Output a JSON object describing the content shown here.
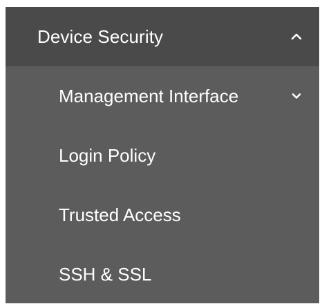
{
  "menu": {
    "section": {
      "label": "Device Security",
      "icon": "chevron-up-icon",
      "expanded": true
    },
    "items": [
      {
        "label": "Management Interface",
        "icon": "chevron-down-icon"
      },
      {
        "label": "Login Policy"
      },
      {
        "label": "Trusted Access"
      },
      {
        "label": "SSH & SSL"
      }
    ],
    "colors": {
      "header_bg": "#4a4a4a",
      "panel_bg": "#5c5c5c",
      "text": "#ffffff"
    }
  }
}
